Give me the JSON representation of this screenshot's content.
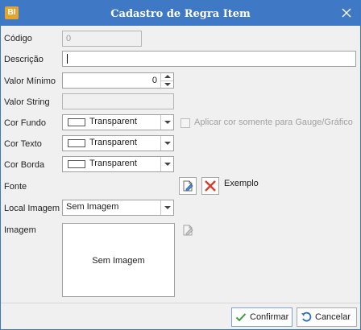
{
  "window": {
    "title": "Cadastro de Regra Item",
    "app_icon_text": "BI",
    "accent_color": "#3f79c5"
  },
  "form": {
    "codigo": {
      "label": "Código",
      "value": "0"
    },
    "descricao": {
      "label": "Descrição",
      "value": ""
    },
    "valor_minimo": {
      "label": "Valor Mínimo",
      "value": "0"
    },
    "valor_string": {
      "label": "Valor String",
      "value": ""
    },
    "cor_fundo": {
      "label": "Cor Fundo",
      "value": "Transparent"
    },
    "aplicar_gauge": {
      "label": "Aplicar cor somente para Gauge/Gráfico",
      "checked": false
    },
    "cor_texto": {
      "label": "Cor Texto",
      "value": "Transparent"
    },
    "cor_borda": {
      "label": "Cor Borda",
      "value": "Transparent"
    },
    "fonte": {
      "label": "Fonte",
      "example": "Exemplo",
      "edit_icon": "edit-icon",
      "clear_icon": "close-red-icon"
    },
    "local_imagem": {
      "label": "Local Imagem",
      "value": "Sem Imagem"
    },
    "imagem": {
      "label": "Imagem",
      "placeholder": "Sem Imagem",
      "edit_icon": "edit-icon"
    }
  },
  "footer": {
    "confirm_label": "Confirmar",
    "cancel_label": "Cancelar"
  }
}
